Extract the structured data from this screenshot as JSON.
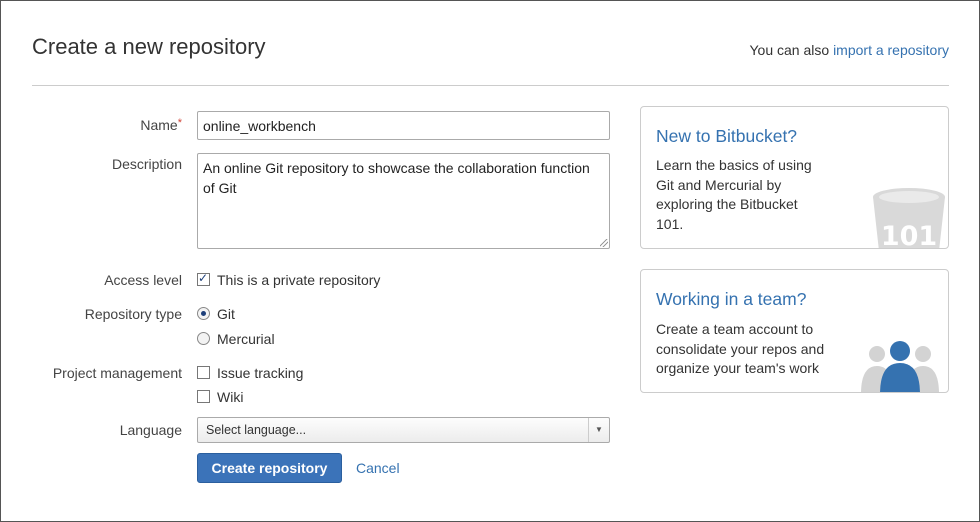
{
  "header": {
    "title": "Create a new repository",
    "import_prefix": "You can also",
    "import_link": "import a repository"
  },
  "form": {
    "name_label": "Name",
    "required_mark": "*",
    "name_value": "online_workbench",
    "description_label": "Description",
    "description_value": "An online Git repository to showcase the collaboration function of Git",
    "access_label": "Access level",
    "private_label": "This is a private repository",
    "private_checked": true,
    "type_label": "Repository type",
    "type_options": [
      "Git",
      "Mercurial"
    ],
    "type_selected": "Git",
    "pm_label": "Project management",
    "pm_options": [
      "Issue tracking",
      "Wiki"
    ],
    "language_label": "Language",
    "language_value": "Select language...",
    "create_label": "Create repository",
    "cancel_label": "Cancel"
  },
  "panels": {
    "new": {
      "title": "New to Bitbucket?",
      "lines": [
        "Learn the basics of using",
        "Git and Mercurial by",
        "exploring the Bitbucket",
        "101."
      ],
      "badge": "101"
    },
    "team": {
      "title": "Working in a team?",
      "lines": [
        "Create a team account to",
        "consolidate your repos and",
        "organize your team's work"
      ]
    }
  },
  "colors": {
    "link": "#3572b0",
    "primary_button": "#3b73b9",
    "required": "#d04437"
  }
}
